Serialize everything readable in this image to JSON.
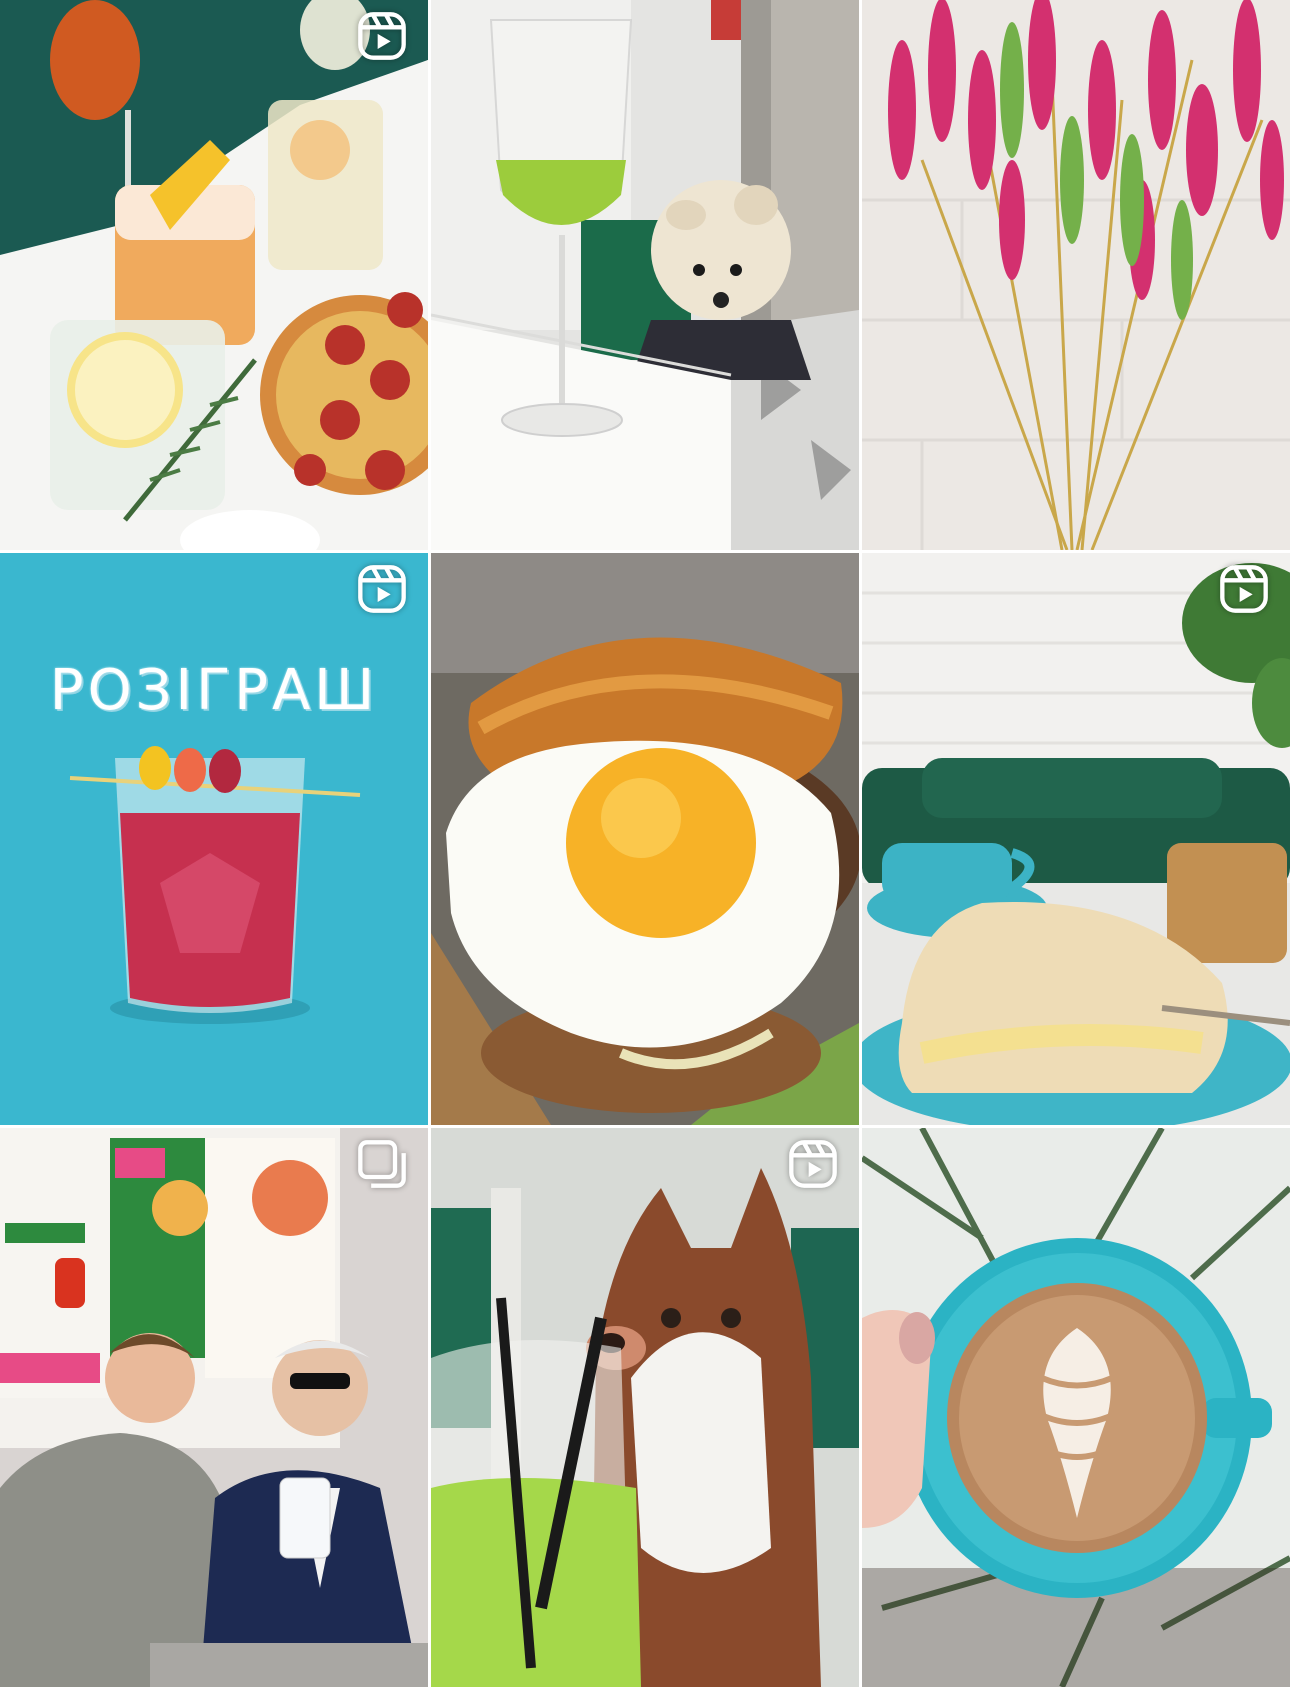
{
  "grid": {
    "posts": [
      {
        "name": "post-cocktails-pizza",
        "type": "reel",
        "badge_icon": "reel-icon"
      },
      {
        "name": "post-green-wine-dog",
        "type": "photo",
        "badge_icon": ""
      },
      {
        "name": "post-pink-wheat",
        "type": "photo",
        "badge_icon": ""
      },
      {
        "name": "post-giveaway-drink",
        "type": "reel",
        "badge_icon": "reel-icon",
        "text": "РОЗІГРАШ"
      },
      {
        "name": "post-egg-burger",
        "type": "photo",
        "badge_icon": ""
      },
      {
        "name": "post-napoleon-cake-coffee",
        "type": "reel",
        "badge_icon": "reel-icon"
      },
      {
        "name": "post-menu-board-people",
        "type": "carousel",
        "badge_icon": "carousel-icon"
      },
      {
        "name": "post-husky-green-drink",
        "type": "reel",
        "badge_icon": "reel-icon"
      },
      {
        "name": "post-latte-art-cup",
        "type": "photo",
        "badge_icon": ""
      }
    ]
  },
  "colors": {
    "giveaway_bg": "#3ab7cf",
    "cup_blue": "#2bb3c4",
    "green_drink": "#a9d84a",
    "pink_wheat": "#d3306f"
  }
}
